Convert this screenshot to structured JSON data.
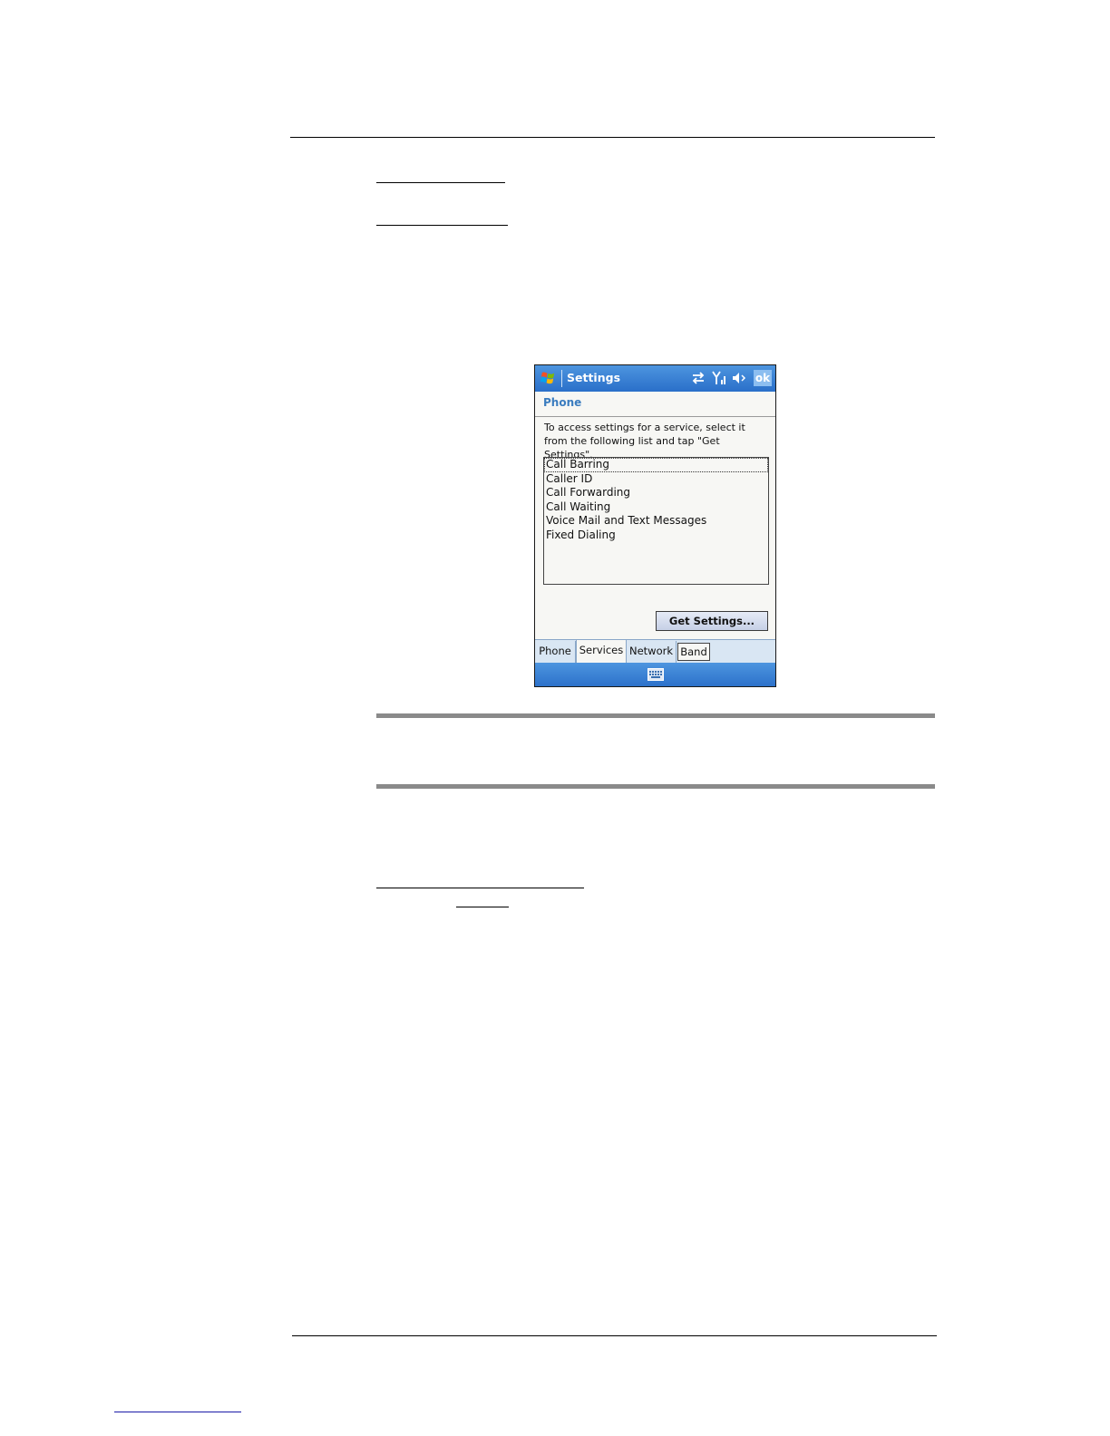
{
  "device": {
    "title": "Settings",
    "ok_label": "ok",
    "heading": "Phone",
    "instructions": "To access settings for a service, select it from the following list and tap \"Get Settings\".",
    "services": [
      "Call Barring",
      "Caller ID",
      "Call Forwarding",
      "Call Waiting",
      "Voice Mail and Text Messages",
      "Fixed Dialing"
    ],
    "get_settings_label": "Get Settings...",
    "tabs": [
      "Phone",
      "Services",
      "Network",
      "Band"
    ],
    "active_tab": "Services",
    "icons": [
      "windows-start-icon",
      "connectivity-icon",
      "signal-icon",
      "speaker-muted-icon",
      "keyboard-icon"
    ],
    "colors": {
      "titlebar": "#2a6fc9",
      "heading": "#3a7cbf",
      "tabstrip": "#d9e6f3"
    }
  }
}
